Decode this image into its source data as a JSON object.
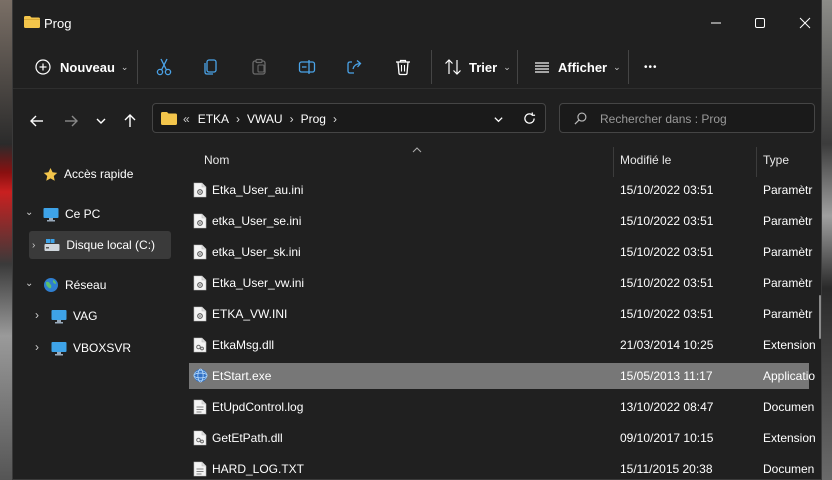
{
  "window": {
    "title": "Prog"
  },
  "command_bar": {
    "new_label": "Nouveau",
    "sort_label": "Trier",
    "view_label": "Afficher",
    "more_label": "•••"
  },
  "address": {
    "overflow": "«",
    "crumbs": [
      "ETKA",
      "VWAU",
      "Prog"
    ]
  },
  "search": {
    "placeholder": "Rechercher dans : Prog"
  },
  "sidebar": {
    "items": [
      {
        "label": "Accès rapide"
      },
      {
        "label": "Ce PC"
      },
      {
        "label": "Disque local (C:)"
      },
      {
        "label": "Réseau"
      },
      {
        "label": "VAG"
      },
      {
        "label": "VBOXSVR"
      }
    ]
  },
  "columns": {
    "name": "Nom",
    "modified": "Modifié le",
    "type": "Type"
  },
  "files": [
    {
      "name": "Etka_User_au.ini",
      "date": "15/10/2022 03:51",
      "type": "Paramètr",
      "icon": "ini-file-icon"
    },
    {
      "name": "etka_User_se.ini",
      "date": "15/10/2022 03:51",
      "type": "Paramètr",
      "icon": "ini-file-icon"
    },
    {
      "name": "etka_User_sk.ini",
      "date": "15/10/2022 03:51",
      "type": "Paramètr",
      "icon": "ini-file-icon"
    },
    {
      "name": "Etka_User_vw.ini",
      "date": "15/10/2022 03:51",
      "type": "Paramètr",
      "icon": "ini-file-icon"
    },
    {
      "name": "ETKA_VW.INI",
      "date": "15/10/2022 03:51",
      "type": "Paramètr",
      "icon": "ini-file-icon"
    },
    {
      "name": "EtkaMsg.dll",
      "date": "21/03/2014 10:25",
      "type": "Extension",
      "icon": "dll-file-icon"
    },
    {
      "name": "EtStart.exe",
      "date": "15/05/2013 11:17",
      "type": "Applicatio",
      "icon": "globe-app-icon"
    },
    {
      "name": "EtUpdControl.log",
      "date": "13/10/2022 08:47",
      "type": "Documen",
      "icon": "text-file-icon"
    },
    {
      "name": "GetEtPath.dll",
      "date": "09/10/2017 10:15",
      "type": "Extension",
      "icon": "dll-file-icon"
    },
    {
      "name": "HARD_LOG.TXT",
      "date": "15/11/2015 20:38",
      "type": "Documen",
      "icon": "text-file-icon"
    }
  ],
  "selected_file_index": 6,
  "colors": {
    "window_bg": "#202020",
    "selected_row": "#777777",
    "folder": "#f3c54b",
    "accent_blue": "#4aa3e8"
  }
}
